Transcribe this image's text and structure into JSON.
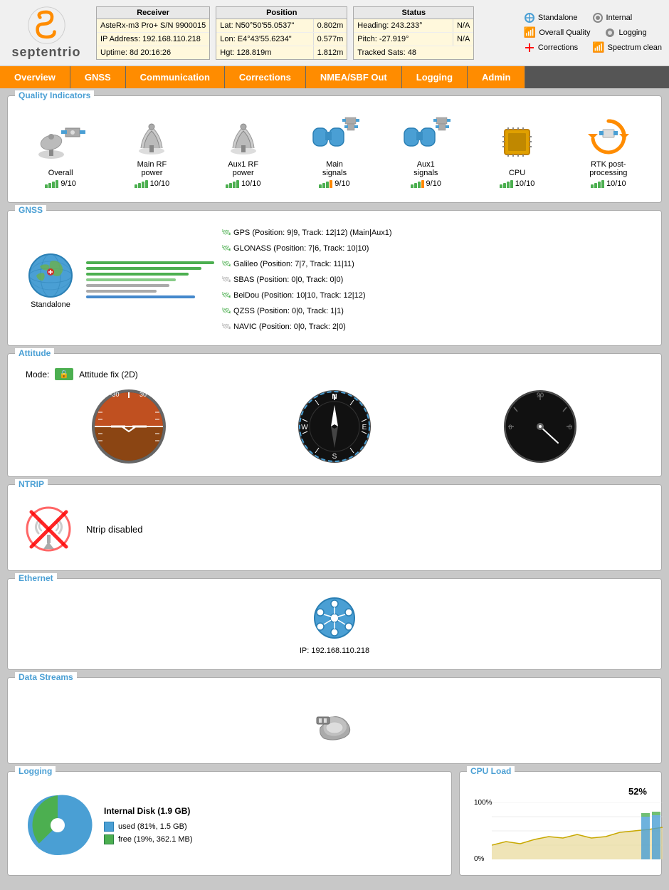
{
  "header": {
    "logo_text": "septentrio",
    "receiver": {
      "title": "Receiver",
      "rows": [
        {
          "label": "AsteRx-m3 Pro+ S/N 9900015"
        },
        {
          "label": "IP Address: 192.168.110.218"
        },
        {
          "label": "Uptime: 8d 20:16:26"
        }
      ]
    },
    "position": {
      "title": "Position",
      "rows": [
        {
          "label": "Lat: N50°50'55.0537\"",
          "value": "0.802m"
        },
        {
          "label": "Lon: E4°43'55.6234\"",
          "value": "0.577m"
        },
        {
          "label": "Hgt: 128.819m",
          "value": "1.812m"
        }
      ]
    },
    "status": {
      "title": "Status",
      "rows": [
        {
          "label": "Heading: 243.233°",
          "value": "N/A"
        },
        {
          "label": "Pitch: -27.919°",
          "value": "N/A"
        },
        {
          "label": "Tracked Sats: 48"
        }
      ]
    },
    "legend": {
      "standalone": "Standalone",
      "internal": "Internal",
      "overall_quality": "Overall Quality",
      "logging": "Logging",
      "corrections": "Corrections",
      "spectrum_clean": "Spectrum clean"
    }
  },
  "nav": {
    "items": [
      "Overview",
      "GNSS",
      "Communication",
      "Corrections",
      "NMEA/SBF Out",
      "Logging",
      "Admin"
    ]
  },
  "sections": {
    "quality_indicators": {
      "title": "Quality Indicators",
      "items": [
        {
          "label": "Overall",
          "score": "9/10",
          "bars": 9
        },
        {
          "label": "Main RF power",
          "score": "10/10",
          "bars": 10
        },
        {
          "label": "Aux1 RF power",
          "score": "10/10",
          "bars": 10
        },
        {
          "label": "Main signals",
          "score": "9/10",
          "bars": 9
        },
        {
          "label": "Aux1 signals",
          "score": "9/10",
          "bars": 9
        },
        {
          "label": "CPU",
          "score": "10/10",
          "bars": 10
        },
        {
          "label": "RTK post-processing",
          "score": "10/10",
          "bars": 10
        }
      ]
    },
    "gnss": {
      "title": "GNSS",
      "mode": "Standalone",
      "satellites": [
        "GPS (Position: 9|9, Track: 12|12) (Main|Aux1)",
        "GLONASS (Position: 7|6, Track: 10|10)",
        "Galileo (Position: 7|7, Track: 11|11)",
        "SBAS (Position: 0|0, Track: 0|0)",
        "BeiDou (Position: 10|10, Track: 12|12)",
        "QZSS (Position: 0|0, Track: 1|1)",
        "NAVIC (Position: 0|0, Track: 2|0)"
      ]
    },
    "attitude": {
      "title": "Attitude",
      "mode": "Attitude fix (2D)"
    },
    "ntrip": {
      "title": "NTRIP",
      "status": "Ntrip disabled"
    },
    "ethernet": {
      "title": "Ethernet",
      "ip": "IP: 192.168.110.218"
    },
    "data_streams": {
      "title": "Data Streams"
    },
    "logging": {
      "title": "Logging",
      "disk_title": "Internal Disk (1.9 GB)",
      "used_label": "used (81%, 1.5 GB)",
      "free_label": "free (19%, 362.1 MB)",
      "used_pct": 81,
      "free_pct": 19
    },
    "cpu_load": {
      "title": "CPU Load",
      "percentage": "52%",
      "label_100": "100%",
      "label_0": "0%"
    }
  }
}
